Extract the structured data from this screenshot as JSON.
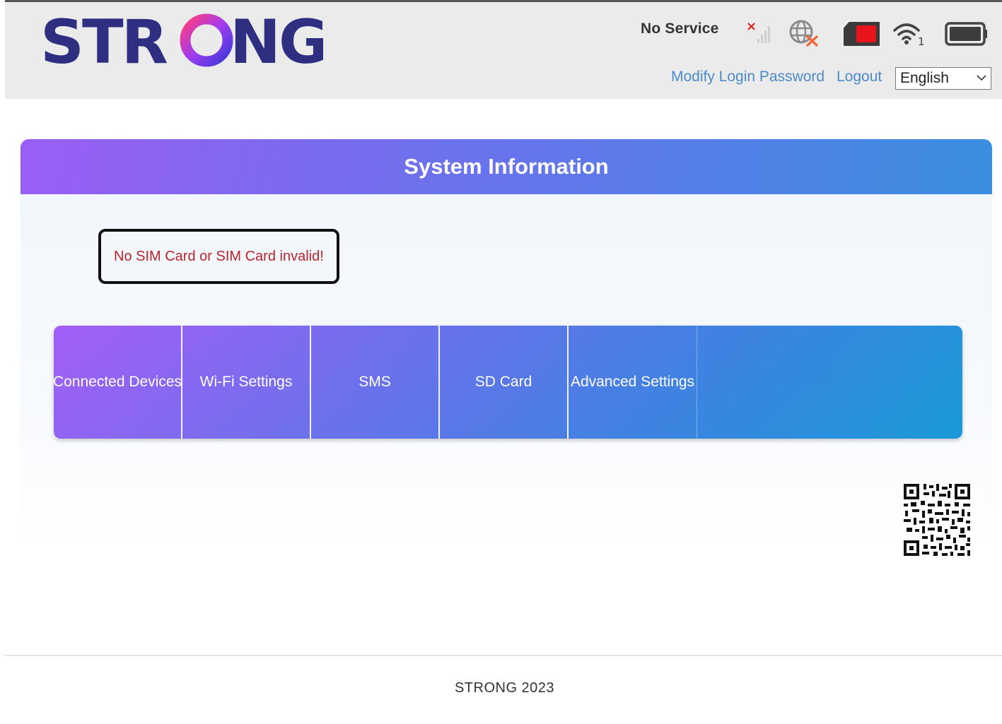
{
  "header": {
    "logo_text": "STRONG",
    "status": "No Service",
    "links": {
      "modify_password": "Modify Login Password",
      "logout": "Logout"
    },
    "language": {
      "selected": "English"
    },
    "icons": {
      "signal": "signal-no-service-icon",
      "network": "globe-disconnected-icon",
      "sim": "sim-card-icon",
      "wifi": "wifi-icon",
      "wifi_client_count": "1",
      "battery": "battery-icon"
    },
    "colors": {
      "logo": "#2e2f80",
      "link": "#4c8ac8",
      "alert": "#b5262b"
    }
  },
  "main": {
    "title": "System Information",
    "alert": "No SIM Card or SIM Card invalid!",
    "nav": [
      {
        "label": "Connected Devices"
      },
      {
        "label": "Wi-Fi Settings"
      },
      {
        "label": "SMS"
      },
      {
        "label": "SD Card"
      },
      {
        "label": "Advanced Settings"
      }
    ]
  },
  "footer": {
    "text": "STRONG 2023"
  }
}
